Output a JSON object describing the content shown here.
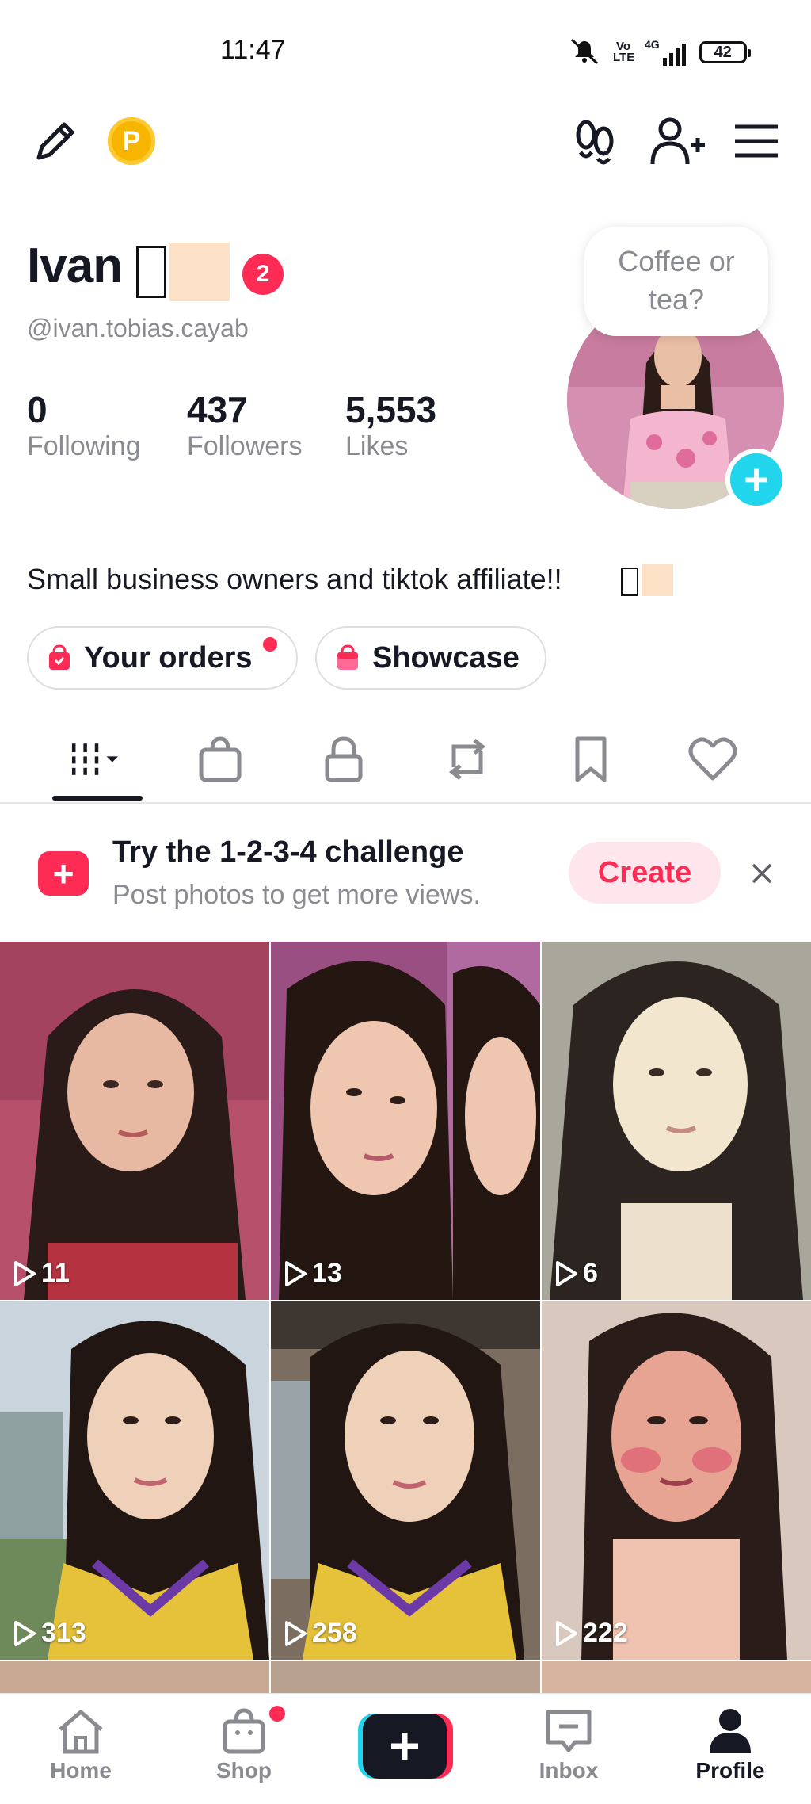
{
  "status_bar": {
    "time": "11:47",
    "volte_label": "Vo LTE",
    "network_label": "4G",
    "battery": "42",
    "icons": [
      "mute-icon",
      "volte-icon",
      "signal-icon",
      "battery-icon"
    ]
  },
  "header": {
    "icons": [
      "pencil-icon",
      "p-coin-icon",
      "footprints-icon",
      "add-user-icon",
      "menu-icon"
    ],
    "coin_label": "P"
  },
  "profile": {
    "name": "Ivan",
    "notification_count": "2",
    "username": "@ivan.tobias.cayab",
    "stats": [
      {
        "value": "0",
        "label": "Following"
      },
      {
        "value": "437",
        "label": "Followers"
      },
      {
        "value": "5,553",
        "label": "Likes"
      }
    ],
    "bubble_text_line1": "Coffee or",
    "bubble_text_line2": "tea?",
    "add_label": "+",
    "bio": "Small business owners and tiktok affiliate!!"
  },
  "pills": {
    "orders_label": "Your orders",
    "showcase_label": "Showcase"
  },
  "tabs": {
    "icons": [
      "grid-icon",
      "shop-bag-icon",
      "lock-icon",
      "repost-icon",
      "bookmark-icon",
      "heart-icon"
    ],
    "active": "grid-icon"
  },
  "banner": {
    "title": "Try the 1-2-3-4 challenge",
    "subtitle": "Post photos to get more views.",
    "create_label": "Create"
  },
  "videos": [
    {
      "views": "11"
    },
    {
      "views": "13"
    },
    {
      "views": "6"
    },
    {
      "views": "313"
    },
    {
      "views": "258"
    },
    {
      "views": "222"
    }
  ],
  "bottom_nav": {
    "items": [
      {
        "label": "Home",
        "icon": "home-icon"
      },
      {
        "label": "Shop",
        "icon": "shop-icon"
      },
      {
        "label": "",
        "icon": "create-plus-icon"
      },
      {
        "label": "Inbox",
        "icon": "inbox-icon"
      },
      {
        "label": "Profile",
        "icon": "profile-icon"
      }
    ],
    "active": "Profile"
  },
  "colors": {
    "accent": "#fe2c55",
    "cyan": "#20d5ec",
    "text": "#161823",
    "muted": "#8a8b91"
  }
}
